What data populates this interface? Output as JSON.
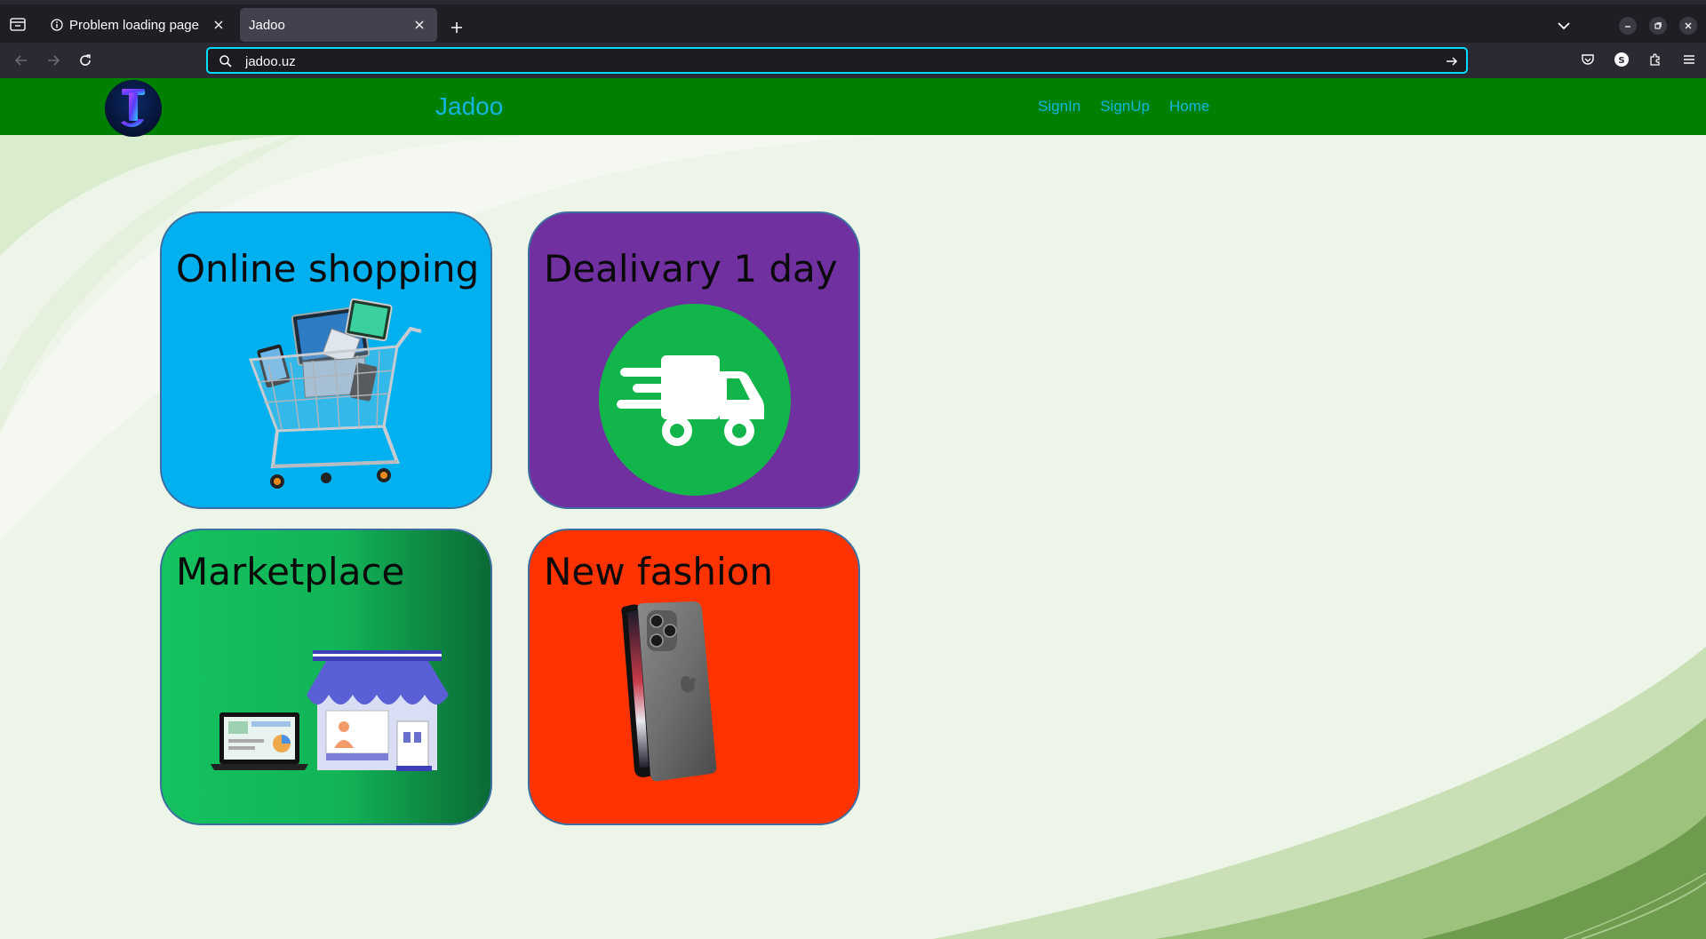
{
  "browser": {
    "tabs": [
      {
        "label": "Problem loading page",
        "icon": "info-icon",
        "active": false
      },
      {
        "label": "Jadoo",
        "icon": "",
        "active": true
      }
    ],
    "url": "jadoo.uz",
    "accent": "#00ddff"
  },
  "site": {
    "title": "Jadoo",
    "nav": [
      "SignIn",
      "SignUp",
      "Home"
    ],
    "header_color": "#008000",
    "link_color": "#11b6e0"
  },
  "cards": [
    {
      "title": "Online shopping",
      "color": "#00b0ef",
      "image": "shopping-cart-electronics"
    },
    {
      "title": "Dealivary 1 day",
      "color": "#7030a0",
      "image": "delivery-truck-icon"
    },
    {
      "title": "Marketplace",
      "color": "#12b457",
      "image": "marketplace-store-laptop"
    },
    {
      "title": "New fashion",
      "color": "#ff3300",
      "image": "smartphone"
    }
  ]
}
